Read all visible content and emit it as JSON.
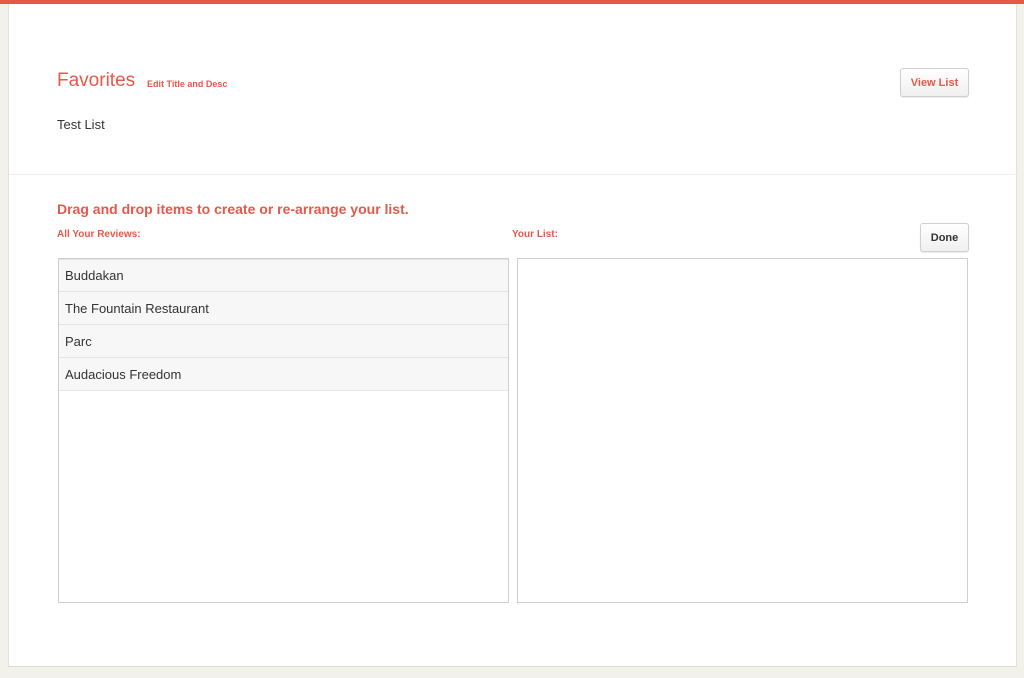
{
  "colors": {
    "accent": "#e4594a",
    "text": "#333333",
    "item_bg": "#f7f7f7"
  },
  "header": {
    "list_title": "Favorites",
    "edit_link": "Edit Title and Desc",
    "description": "Test List",
    "view_list_label": "View List"
  },
  "editor": {
    "instructions": "Drag and drop items to create or re-arrange your list.",
    "reviews_label": "All Your Reviews:",
    "your_list_label": "Your List:",
    "done_label": "Done",
    "reviews": [
      {
        "label": "Buddakan"
      },
      {
        "label": "The Fountain Restaurant"
      },
      {
        "label": "Parc"
      },
      {
        "label": "Audacious Freedom"
      }
    ],
    "your_list": []
  }
}
